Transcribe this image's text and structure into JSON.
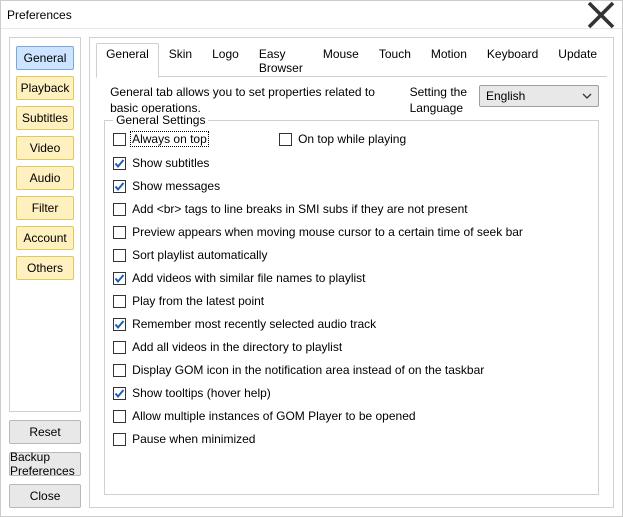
{
  "window": {
    "title": "Preferences"
  },
  "sidebar": {
    "items": [
      {
        "label": "General",
        "active": true
      },
      {
        "label": "Playback",
        "active": false
      },
      {
        "label": "Subtitles",
        "active": false
      },
      {
        "label": "Video",
        "active": false
      },
      {
        "label": "Audio",
        "active": false
      },
      {
        "label": "Filter",
        "active": false
      },
      {
        "label": "Account",
        "active": false
      },
      {
        "label": "Others",
        "active": false
      }
    ],
    "bottom": {
      "reset": "Reset",
      "backup": "Backup Preferences",
      "close": "Close"
    }
  },
  "tabs": [
    {
      "label": "General",
      "active": true
    },
    {
      "label": "Skin",
      "active": false
    },
    {
      "label": "Logo",
      "active": false
    },
    {
      "label": "Easy Browser",
      "active": false
    },
    {
      "label": "Mouse",
      "active": false
    },
    {
      "label": "Touch",
      "active": false
    },
    {
      "label": "Motion",
      "active": false
    },
    {
      "label": "Keyboard",
      "active": false
    },
    {
      "label": "Update",
      "active": false
    }
  ],
  "description": {
    "text": "General tab allows you to set properties related to basic operations.",
    "lang_label_line1": "Setting the",
    "lang_label_line2": "Language",
    "lang_value": "English"
  },
  "fieldset_title": "General Settings",
  "settings": [
    {
      "label": "Always on top",
      "checked": false,
      "focused": true,
      "pair_label": "On top while playing",
      "pair_checked": false
    },
    {
      "label": "Show subtitles",
      "checked": true
    },
    {
      "label": "Show messages",
      "checked": true
    },
    {
      "label": "Add <br> tags to line breaks in SMI subs if they are not present",
      "checked": false
    },
    {
      "label": "Preview appears when moving mouse cursor to a certain time of seek bar",
      "checked": false
    },
    {
      "label": "Sort playlist automatically",
      "checked": false
    },
    {
      "label": "Add videos with similar file names to playlist",
      "checked": true
    },
    {
      "label": "Play from the latest point",
      "checked": false
    },
    {
      "label": "Remember most recently selected audio track",
      "checked": true
    },
    {
      "label": "Add all videos in the directory to playlist",
      "checked": false
    },
    {
      "label": "Display GOM icon in the notification area instead of on the taskbar",
      "checked": false
    },
    {
      "label": "Show tooltips (hover help)",
      "checked": true
    },
    {
      "label": "Allow multiple instances of GOM Player to be opened",
      "checked": false
    },
    {
      "label": "Pause when minimized",
      "checked": false
    }
  ]
}
